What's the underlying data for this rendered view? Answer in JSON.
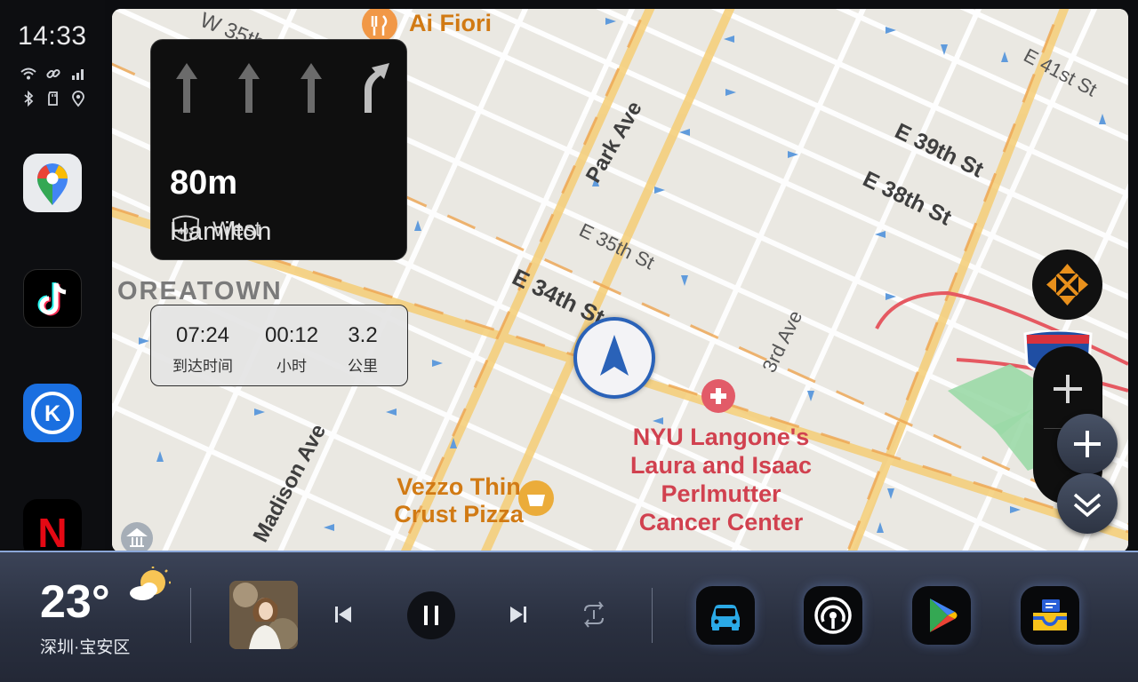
{
  "status": {
    "time": "14:33"
  },
  "rail_apps": [
    {
      "name": "Google Maps",
      "icon": "google-maps-icon"
    },
    {
      "name": "TikTok",
      "icon": "tiktok-icon"
    },
    {
      "name": "Kugou",
      "icon": "kugou-icon",
      "letter": "K"
    },
    {
      "name": "Netflix",
      "icon": "netflix-icon",
      "letter": "N"
    }
  ],
  "map": {
    "streets": [
      "W 35th",
      "Park Ave",
      "E 41st St",
      "E 39th St",
      "E 38th St",
      "E 35th St",
      "E 34th St",
      "3rd Ave",
      "Madison Ave",
      "OREATOWN"
    ],
    "poi": {
      "restaurant": "Ai Fiori",
      "pizza_line1": "Vezzo Thin",
      "pizza_line2": "Crust Pizza",
      "hospital_line1": "NYU Langone's",
      "hospital_line2": "Laura and Isaac",
      "hospital_line3": "Perlmutter",
      "hospital_line4": "Cancer Center"
    }
  },
  "guidance": {
    "distance": "80m",
    "route_shield": "403",
    "direction": "West",
    "next_street": "Hamilton"
  },
  "eta": {
    "arrival_time": "07:24",
    "arrival_label": "到达时间",
    "duration": "00:12",
    "duration_label": "小时",
    "distance": "3.2",
    "distance_label": "公里"
  },
  "weather": {
    "temperature": "23°",
    "location": "深圳·宝安区"
  },
  "media": {
    "state": "playing"
  },
  "dock_apps": [
    {
      "name": "Car",
      "icon": "car-icon"
    },
    {
      "name": "Broadcast",
      "icon": "radio-signal-icon"
    },
    {
      "name": "Play Store",
      "icon": "google-play-icon"
    },
    {
      "name": "Files",
      "icon": "inbox-tray-icon"
    }
  ],
  "colors": {
    "road_major": "#f4c96b",
    "road_minor": "#ffffff",
    "map_bg": "#e7e5df",
    "puck_ring": "#2a62b8",
    "poi_red": "#d1414f",
    "poi_orange": "#d17a14"
  }
}
